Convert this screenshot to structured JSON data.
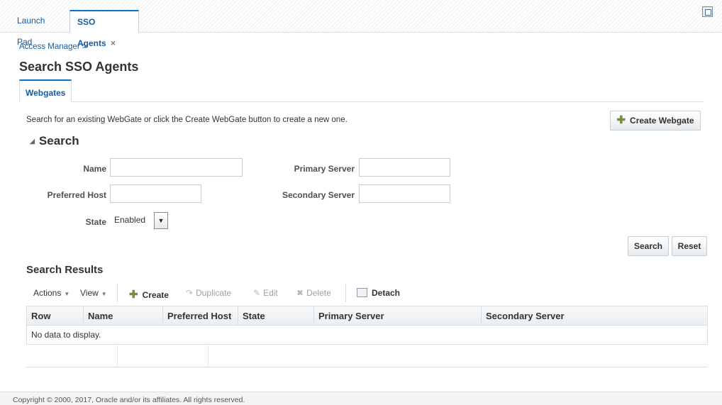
{
  "tabs": {
    "launch_pad": "Launch Pad",
    "sso_agents": "SSO Agents",
    "close_glyph": "×"
  },
  "breadcrumb": "Access Manager >",
  "page_title": "Search SSO Agents",
  "subtab": "Webgates",
  "instruction": "Search for an existing WebGate or click the Create WebGate button to create a new one.",
  "create_webgate_label": "Create Webgate",
  "search_section": {
    "title": "Search",
    "fields": {
      "name_label": "Name",
      "name_value": "",
      "preferred_host_label": "Preferred Host",
      "preferred_host_value": "",
      "primary_server_label": "Primary Server",
      "primary_server_value": "",
      "secondary_server_label": "Secondary Server",
      "secondary_server_value": "",
      "state_label": "State",
      "state_value": "Enabled"
    },
    "search_button": "Search",
    "reset_button": "Reset"
  },
  "results": {
    "title": "Search Results",
    "toolbar": {
      "actions": "Actions",
      "view": "View",
      "create": "Create",
      "duplicate": "Duplicate",
      "edit": "Edit",
      "delete": "Delete",
      "detach": "Detach"
    },
    "columns": [
      "Row",
      "Name",
      "Preferred Host",
      "State",
      "Primary Server",
      "Secondary Server"
    ],
    "empty_text": "No data to display."
  },
  "footer": "Copyright © 2000, 2017, Oracle and/or its affiliates. All rights reserved.",
  "colors": {
    "link": "#145c9e",
    "accent": "#0572ce",
    "border": "#d6dfe6"
  }
}
